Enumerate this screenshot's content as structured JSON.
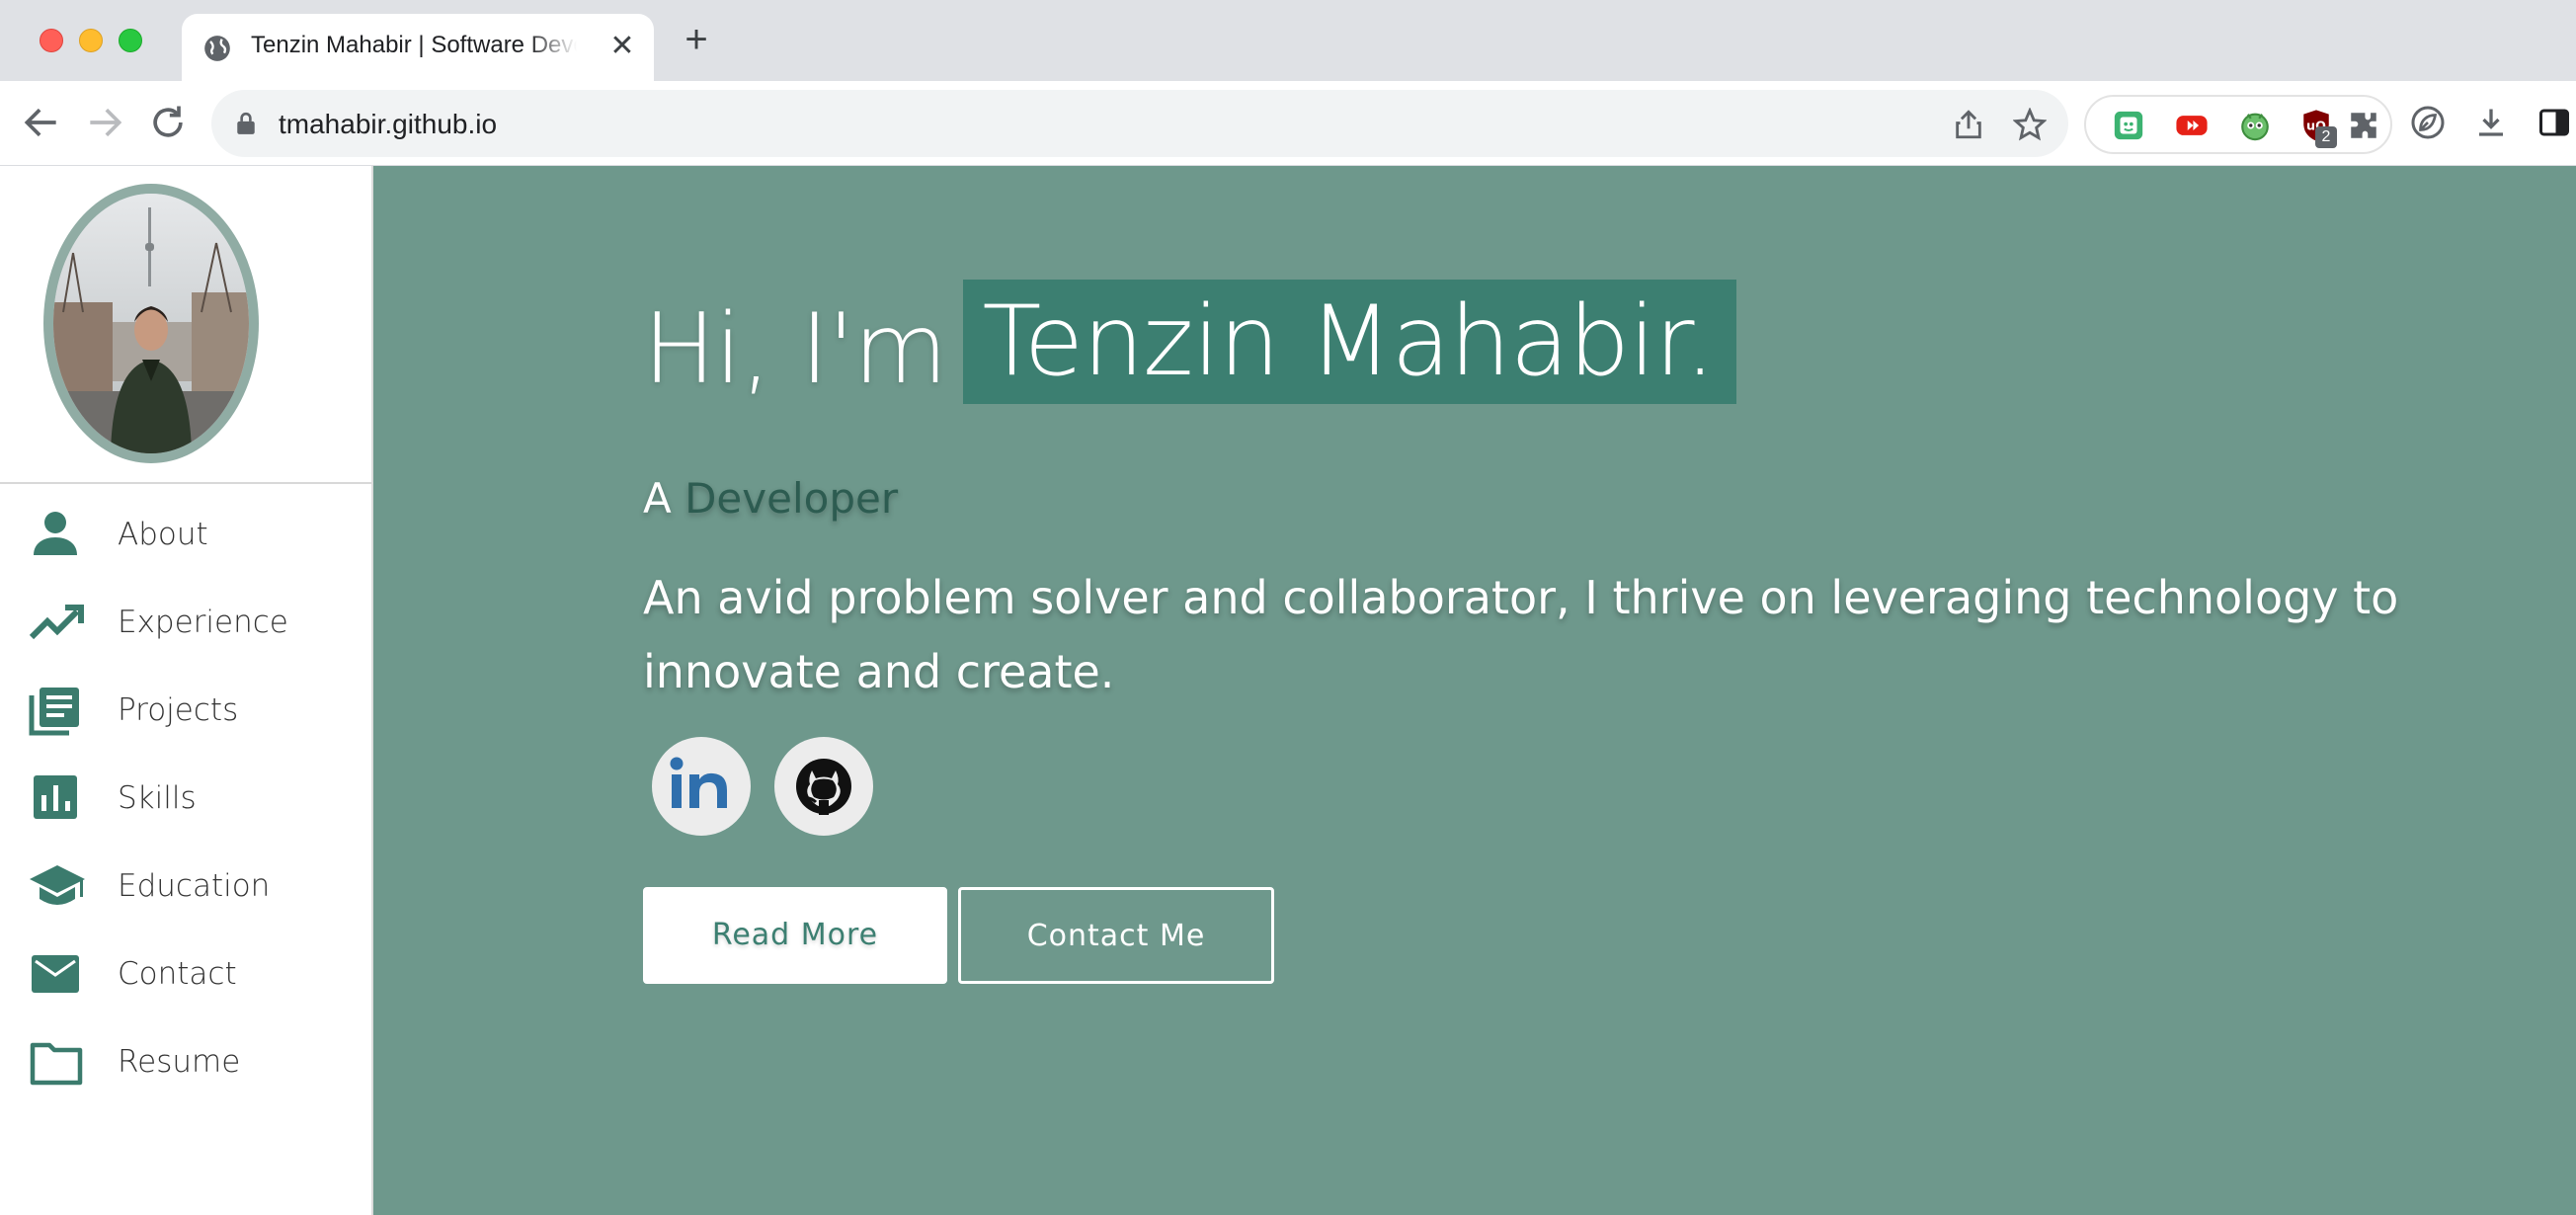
{
  "browser": {
    "tab_title": "Tenzin Mahabir | Software Developer",
    "tab_close": "✕",
    "new_tab": "+",
    "url": "tmahabir.github.io",
    "ext_badge": "2"
  },
  "sidebar": {
    "nav": [
      {
        "label": "About",
        "icon": "person-icon"
      },
      {
        "label": "Experience",
        "icon": "trending-up-icon"
      },
      {
        "label": "Projects",
        "icon": "library-books-icon"
      },
      {
        "label": "Skills",
        "icon": "bar-chart-icon"
      },
      {
        "label": "Education",
        "icon": "school-icon"
      },
      {
        "label": "Contact",
        "icon": "mail-icon"
      },
      {
        "label": "Resume",
        "icon": "folder-icon"
      }
    ]
  },
  "hero": {
    "greeting_prefix": "Hi, I'm",
    "name": "Tenzin Mahabir.",
    "role_prefix": "A",
    "role_word": "Developer",
    "tagline": "An avid problem solver and collaborator, I thrive on leveraging technology to innovate and create.",
    "buttons": {
      "read_more": "Read More",
      "contact": "Contact Me"
    },
    "social": [
      {
        "name": "LinkedIn",
        "icon": "linkedin-icon"
      },
      {
        "name": "GitHub",
        "icon": "github-icon"
      }
    ]
  },
  "colors": {
    "hero_bg": "#6e988c",
    "accent": "#3c7f71",
    "icon": "#3b7b6d"
  }
}
